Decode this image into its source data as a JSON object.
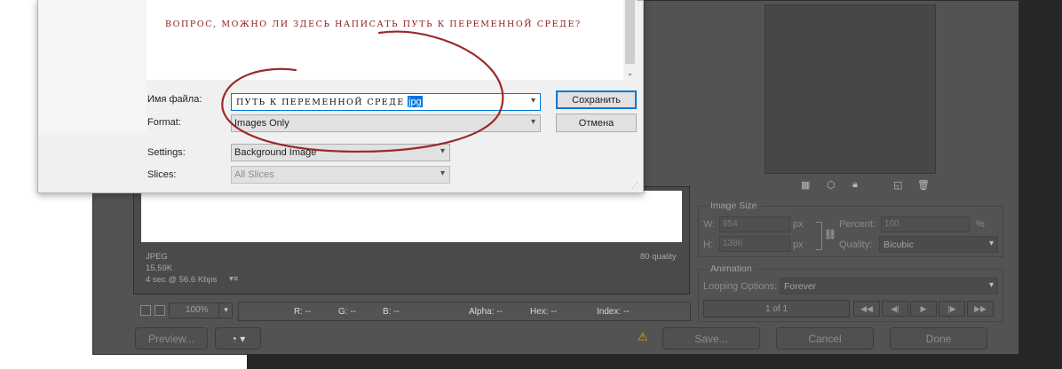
{
  "save_dialog": {
    "file_area_note": "ВОПРОС, МОЖНО ЛИ ЗДЕСЬ НАПИСАТЬ ПУТЬ К ПЕРЕМЕННОЙ СРЕДЕ?",
    "filename_label": "Имя файла:",
    "filename_value": "ПУТЬ К ПЕРЕМЕННОЙ СРЕДЕ",
    "filename_ext": "jpg",
    "format_label": "Format:",
    "format_value": "Images Only",
    "settings_label": "Settings:",
    "settings_value": "Background Image",
    "slices_label": "Slices:",
    "slices_value": "All Slices",
    "save_button": "Сохранить",
    "cancel_button": "Отмена"
  },
  "preview_info": {
    "format": "JPEG",
    "size": "15,59K",
    "speed": "4 sec @ 56.6 Kbps",
    "quality": "80 quality"
  },
  "status_bar": {
    "zoom": "100%",
    "r": "R: --",
    "g": "G: --",
    "b": "B: --",
    "alpha": "Alpha: --",
    "hex": "Hex: --",
    "index": "Index: --"
  },
  "bottom_buttons": {
    "preview": "Preview...",
    "save": "Save...",
    "cancel": "Cancel",
    "done": "Done"
  },
  "image_size": {
    "title": "Image Size",
    "w_label": "W:",
    "w_value": "954",
    "h_label": "H:",
    "h_value": "1386",
    "unit": "px",
    "percent_label": "Percent:",
    "percent_value": "100",
    "percent_unit": "%",
    "quality_label": "Quality:",
    "quality_value": "Bicubic"
  },
  "animation": {
    "title": "Animation",
    "looping_label": "Looping Options:",
    "looping_value": "Forever",
    "frame_counter": "1 of 1"
  },
  "icons": {
    "dropdown": "▾",
    "scroll_down": "⌄",
    "warning": "⚠",
    "link": "⛓"
  },
  "colors": {
    "annotation": "#9b2a2a",
    "accent": "#0078d7",
    "ps_bg": "#535353"
  }
}
